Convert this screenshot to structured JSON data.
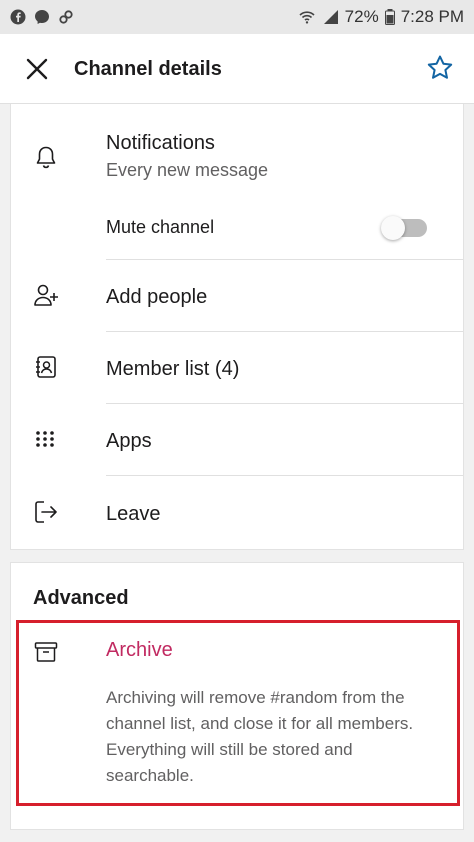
{
  "status_bar": {
    "battery": "72%",
    "time": "7:28 PM"
  },
  "header": {
    "title": "Channel details"
  },
  "settings": {
    "notifications_label": "Notifications",
    "notifications_value": "Every new message",
    "mute_label": "Mute channel",
    "mute_on": false,
    "add_people_label": "Add people",
    "member_list_label": "Member list (4)",
    "apps_label": "Apps",
    "leave_label": "Leave"
  },
  "advanced": {
    "title": "Advanced",
    "archive_label": "Archive",
    "archive_description": "Archiving will remove #random from the channel list, and close it for all members. Everything will still be stored and searchable."
  },
  "colors": {
    "accent_star": "#1264a3",
    "archive_text": "#c12a61",
    "highlight_border": "#d61f2c"
  }
}
